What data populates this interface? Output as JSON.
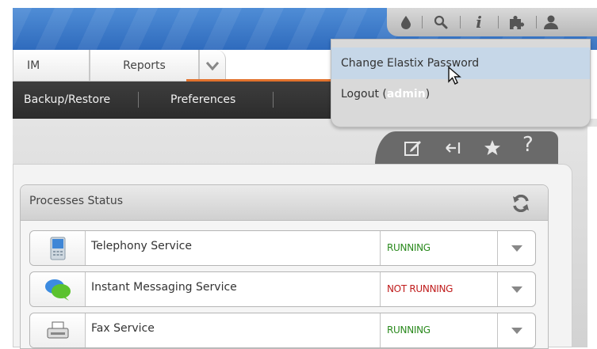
{
  "tabs": [
    {
      "label": "IM"
    },
    {
      "label": "Reports"
    }
  ],
  "menubar": {
    "items": [
      "Backup/Restore",
      "Preferences"
    ]
  },
  "topbar_icons": [
    "water-drop-icon",
    "search-icon",
    "info-icon",
    "puzzle-icon",
    "user-icon"
  ],
  "user_menu": {
    "change_password": "Change Elastix Password",
    "logout_prefix": "Logout (",
    "username": "admin",
    "logout_suffix": ")"
  },
  "toolbar_icons": [
    "edit-icon",
    "collapse-icon",
    "star-icon",
    "help-icon"
  ],
  "panel": {
    "title": "Processes Status",
    "rows": [
      {
        "name": "Telephony Service",
        "status": "RUNNING",
        "icon": "phone-icon"
      },
      {
        "name": "Instant Messaging Service",
        "status": "NOT RUNNING",
        "icon": "chat-bubble-icon"
      },
      {
        "name": "Fax Service",
        "status": "RUNNING",
        "icon": "fax-icon"
      }
    ]
  },
  "colors": {
    "running": "#2b8a1e",
    "not_running": "#c01c1c",
    "accent": "#e2722d",
    "banner": "#3a78c9"
  }
}
